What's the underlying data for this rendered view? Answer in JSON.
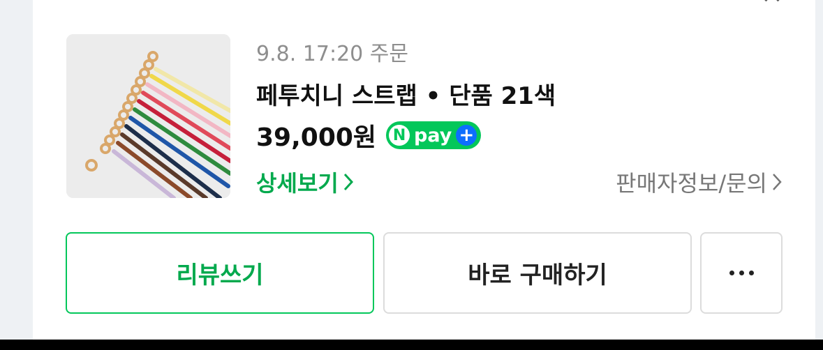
{
  "order": {
    "date_text": "9.8. 17:20 주문",
    "product_name": "페투치니 스트랩 • 단품 21색",
    "price": "39,000원",
    "pay_badge": {
      "letter": "N",
      "text": "pay",
      "plus": "+"
    },
    "detail_link": "상세보기",
    "seller_link": "판매자정보/문의"
  },
  "actions": {
    "review_label": "리뷰쓰기",
    "buy_label": "바로 구매하기",
    "more_icon": "more-dots-icon"
  },
  "colors": {
    "accent_green": "#03c75a",
    "link_green": "#03a94d",
    "npay_plus_blue": "#0d6efd",
    "page_bg": "#eef1f4"
  }
}
